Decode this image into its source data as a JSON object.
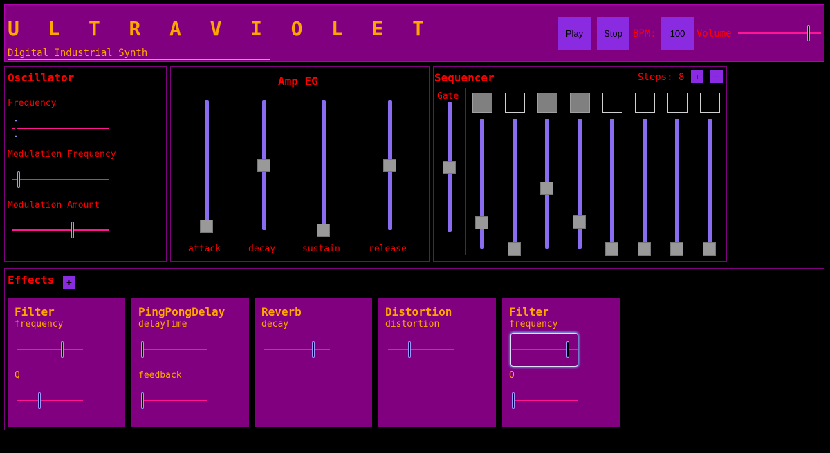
{
  "header": {
    "title": "U L T R A V I O L E T",
    "subtitle": "Digital Industrial Synth",
    "play_label": "Play",
    "stop_label": "Stop",
    "bpm_label": "BPM:",
    "bpm_value": "100",
    "volume_label": "Volume",
    "volume_level": 0.85
  },
  "oscillator": {
    "title": "Oscillator",
    "params": [
      {
        "label": "Frequency",
        "level": 0.04
      },
      {
        "label": "Modulation Frequency",
        "level": 0.07
      },
      {
        "label": "Modulation Amount",
        "level": 0.63
      }
    ]
  },
  "amp_eg": {
    "title": "Amp EG",
    "params": [
      {
        "label": "attack",
        "level": 0.03
      },
      {
        "label": "decay",
        "level": 0.5
      },
      {
        "label": "sustain",
        "level": 0.0
      },
      {
        "label": "release",
        "level": 0.5
      }
    ]
  },
  "sequencer": {
    "title": "Sequencer",
    "steps_label": "Steps: 8",
    "plus_label": "+",
    "minus_label": "−",
    "gate_label": "Gate",
    "gate_level": 0.5,
    "steps": [
      {
        "on": true,
        "level": 0.2
      },
      {
        "on": false,
        "level": 0.0
      },
      {
        "on": true,
        "level": 0.47
      },
      {
        "on": true,
        "level": 0.21
      },
      {
        "on": false,
        "level": 0.0
      },
      {
        "on": false,
        "level": 0.0
      },
      {
        "on": false,
        "level": 0.0
      },
      {
        "on": false,
        "level": 0.0
      }
    ]
  },
  "effects": {
    "title": "Effects",
    "add_label": "+",
    "cards": [
      {
        "name": "Filter",
        "params": [
          {
            "label": "frequency",
            "level": 0.68
          },
          {
            "label": "Q",
            "level": 0.34
          }
        ]
      },
      {
        "name": "PingPongDelay",
        "params": [
          {
            "label": "delayTime",
            "level": 0.02
          },
          {
            "label": "feedback",
            "level": 0.02
          }
        ]
      },
      {
        "name": "Reverb",
        "params": [
          {
            "label": "decay",
            "level": 0.75
          }
        ]
      },
      {
        "name": "Distortion",
        "params": [
          {
            "label": "distortion",
            "level": 0.33
          }
        ]
      },
      {
        "name": "Filter",
        "params": [
          {
            "label": "frequency",
            "level": 0.85
          },
          {
            "label": "Q",
            "level": 0.02
          }
        ]
      }
    ]
  },
  "colors": {
    "background": "#000000",
    "panel_purple": "#800080",
    "accent_violet": "#8a2be2",
    "text_red": "#ff0000",
    "text_orange": "#ffa500",
    "slider_track_pink": "#ff1493",
    "vslider_track": "#8a6cf0"
  }
}
